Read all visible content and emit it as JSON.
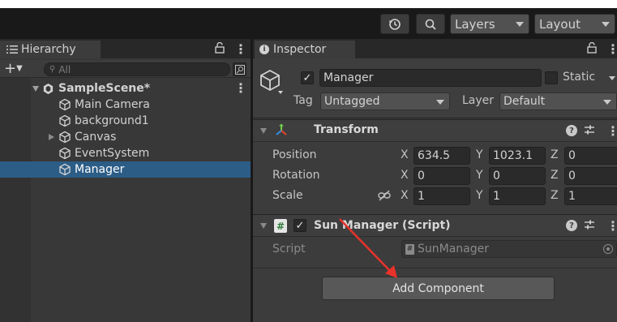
{
  "toolbar": {
    "history_icon": "history-icon",
    "search_icon": "search-icon",
    "layers_label": "Layers",
    "layout_label": "Layout"
  },
  "hierarchy": {
    "tab_label": "Hierarchy",
    "search_placeholder": "All",
    "scene_name": "SampleScene*",
    "items": [
      {
        "label": "Main Camera",
        "has_children": false,
        "selected": false
      },
      {
        "label": "background1",
        "has_children": false,
        "selected": false
      },
      {
        "label": "Canvas",
        "has_children": true,
        "selected": false
      },
      {
        "label": "EventSystem",
        "has_children": false,
        "selected": false
      },
      {
        "label": "Manager",
        "has_children": false,
        "selected": true
      }
    ]
  },
  "inspector": {
    "tab_label": "Inspector",
    "object_name": "Manager",
    "active_checked": true,
    "static_label": "Static",
    "static_checked": false,
    "tag_label": "Tag",
    "tag_value": "Untagged",
    "layer_label": "Layer",
    "layer_value": "Default",
    "transform": {
      "title": "Transform",
      "position_label": "Position",
      "rotation_label": "Rotation",
      "scale_label": "Scale",
      "axis_x": "X",
      "axis_y": "Y",
      "axis_z": "Z",
      "position": {
        "x": "634.5",
        "y": "1023.1",
        "z": "0"
      },
      "rotation": {
        "x": "0",
        "y": "0",
        "z": "0"
      },
      "scale": {
        "x": "1",
        "y": "1",
        "z": "1"
      }
    },
    "script_component": {
      "title": "Sun Manager (Script)",
      "enabled": true,
      "script_label": "Script",
      "script_value": "SunManager"
    },
    "add_component_label": "Add Component"
  },
  "colors": {
    "toolbar_bg": "#191919",
    "panel_bg": "#383838",
    "inspector_bg": "#3c3c3c",
    "selection": "#2c5d87",
    "annotation_arrow": "#e8322b"
  }
}
